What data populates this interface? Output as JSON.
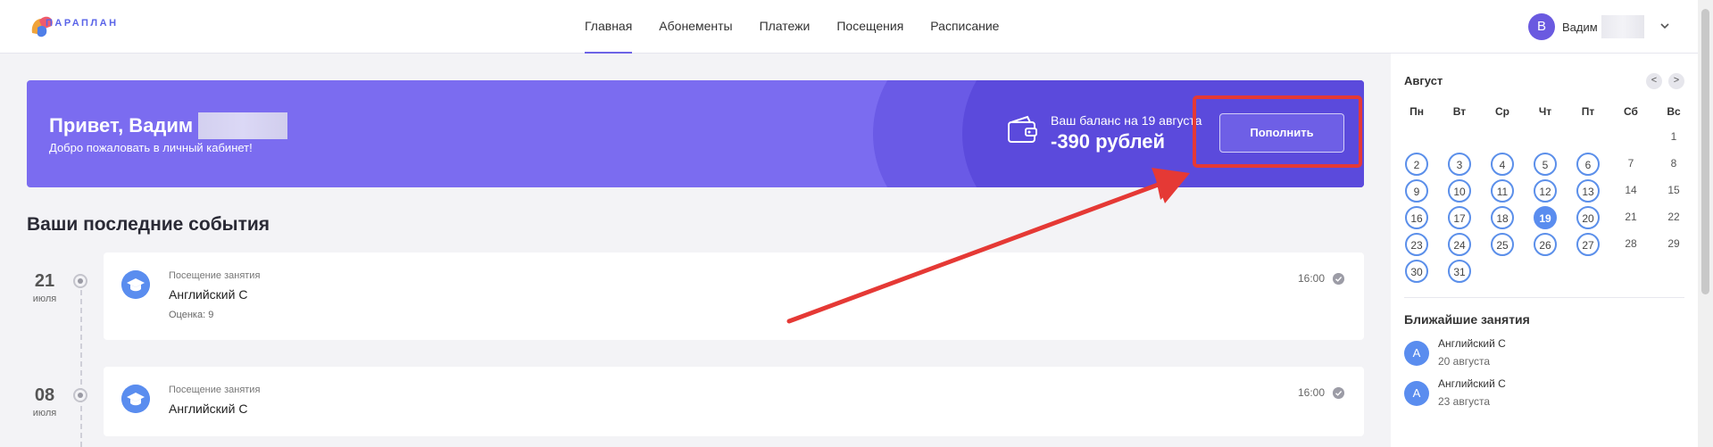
{
  "header": {
    "logo_text": "ПАРАПЛАН",
    "nav": [
      {
        "label": "Главная",
        "active": true
      },
      {
        "label": "Абонементы",
        "active": false
      },
      {
        "label": "Платежи",
        "active": false
      },
      {
        "label": "Посещения",
        "active": false
      },
      {
        "label": "Расписание",
        "active": false
      }
    ],
    "user": {
      "initial": "В",
      "name": "Вадим"
    }
  },
  "banner": {
    "greeting": "Привет, Вадим",
    "welcome": "Добро пожаловать в личный кабинет!",
    "balance_label": "Ваш баланс на 19 августа",
    "balance_value": "-390 рублей",
    "topup_label": "Пополнить"
  },
  "events": {
    "title": "Ваши последние события",
    "items": [
      {
        "day": "21",
        "month": "июля",
        "type": "Посещение занятия",
        "name": "Английский С",
        "grade": "Оценка: 9",
        "time": "16:00"
      },
      {
        "day": "08",
        "month": "июля",
        "type": "Посещение занятия",
        "name": "Английский С",
        "grade": "",
        "time": "16:00"
      }
    ]
  },
  "calendar": {
    "month": "Август",
    "prev": "<",
    "next": ">",
    "weekdays": [
      "Пн",
      "Вт",
      "Ср",
      "Чт",
      "Пт",
      "Сб",
      "Вс"
    ],
    "weeks": [
      [
        "",
        "",
        "",
        "",
        "",
        "",
        "1"
      ],
      [
        "2",
        "3",
        "4",
        "5",
        "6",
        "7",
        "8"
      ],
      [
        "9",
        "10",
        "11",
        "12",
        "13",
        "14",
        "15"
      ],
      [
        "16",
        "17",
        "18",
        "19",
        "20",
        "21",
        "22"
      ],
      [
        "23",
        "24",
        "25",
        "26",
        "27",
        "28",
        "29"
      ],
      [
        "30",
        "31",
        "",
        "",
        "",
        "",
        ""
      ]
    ],
    "marked_days": [
      "2",
      "3",
      "4",
      "5",
      "6",
      "9",
      "10",
      "11",
      "12",
      "13",
      "16",
      "17",
      "18",
      "20",
      "23",
      "24",
      "25",
      "26",
      "27",
      "30",
      "31"
    ],
    "today": "19"
  },
  "upcoming": {
    "title": "Ближайшие занятия",
    "items": [
      {
        "initial": "А",
        "name": "Английский С",
        "date": "20 августа"
      },
      {
        "initial": "А",
        "name": "Английский С",
        "date": "23 августа"
      }
    ]
  },
  "colors": {
    "accent": "#6c63e6",
    "banner": "#7b6cf0",
    "day_mark": "#5b8fea",
    "annotation": "#e53935"
  }
}
